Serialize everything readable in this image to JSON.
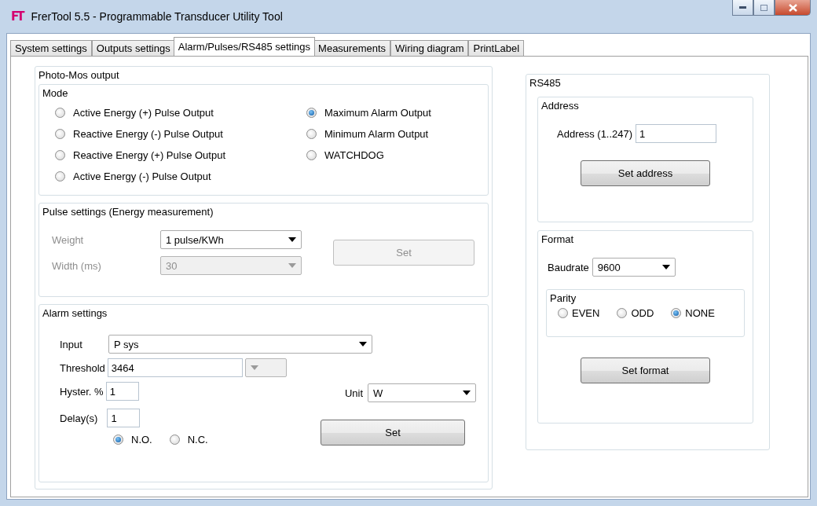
{
  "window": {
    "title": "FrerTool 5.5 -  Programmable Transducer Utility Tool",
    "logo": "FT"
  },
  "tabs": [
    {
      "label": "System settings",
      "selected": false
    },
    {
      "label": "Outputs settings",
      "selected": false
    },
    {
      "label": "Alarm/Pulses/RS485 settings",
      "selected": true
    },
    {
      "label": "Measurements",
      "selected": false
    },
    {
      "label": "Wiring diagram",
      "selected": false
    },
    {
      "label": "PrintLabel",
      "selected": false
    }
  ],
  "photo_mos": {
    "title": "Photo-Mos output",
    "mode": {
      "title": "Mode",
      "options": [
        {
          "label": "Active Energy (+) Pulse Output",
          "selected": false
        },
        {
          "label": "Reactive Energy (-) Pulse Output",
          "selected": false
        },
        {
          "label": "Reactive Energy (+) Pulse Output",
          "selected": false
        },
        {
          "label": "Active Energy (-) Pulse Output",
          "selected": false
        },
        {
          "label": "Maximum Alarm Output",
          "selected": true
        },
        {
          "label": "Minimum Alarm Output",
          "selected": false
        },
        {
          "label": "WATCHDOG",
          "selected": false
        }
      ]
    },
    "pulse_settings": {
      "title": "Pulse settings (Energy measurement)",
      "fields": [
        {
          "label": "Weight",
          "label_disabled": true,
          "value": "1 pulse/KWh",
          "disabled": false
        },
        {
          "label": "Width (ms)",
          "label_disabled": true,
          "value": "30",
          "disabled": true
        }
      ],
      "button": {
        "label": "Set",
        "disabled": true
      }
    },
    "alarm_settings": {
      "title": "Alarm settings",
      "input": {
        "label": "Input",
        "value": "P sys"
      },
      "threshold": {
        "label": "Threshold",
        "value": "3464"
      },
      "threshold_unit": {
        "disabled": true
      },
      "hysteresis": {
        "label": "Hyster. %",
        "value": "1"
      },
      "delay": {
        "label": "Delay(s)",
        "value": "1"
      },
      "contact": [
        {
          "label": "N.O.",
          "selected": true
        },
        {
          "label": "N.C.",
          "selected": false
        }
      ],
      "unit": {
        "label": "Unit",
        "value": "W"
      },
      "button": {
        "label": "Set",
        "disabled": false
      }
    }
  },
  "rs485": {
    "title": "RS485",
    "address": {
      "title": "Address",
      "label": "Address (1..247)",
      "value": "1",
      "button": "Set address"
    },
    "format": {
      "title": "Format",
      "baudrate": {
        "label": "Baudrate",
        "value": "9600"
      },
      "parity": {
        "title": "Parity",
        "options": [
          {
            "label": "EVEN",
            "selected": false
          },
          {
            "label": "ODD",
            "selected": false
          },
          {
            "label": "NONE",
            "selected": true
          }
        ]
      },
      "button": "Set format"
    }
  }
}
